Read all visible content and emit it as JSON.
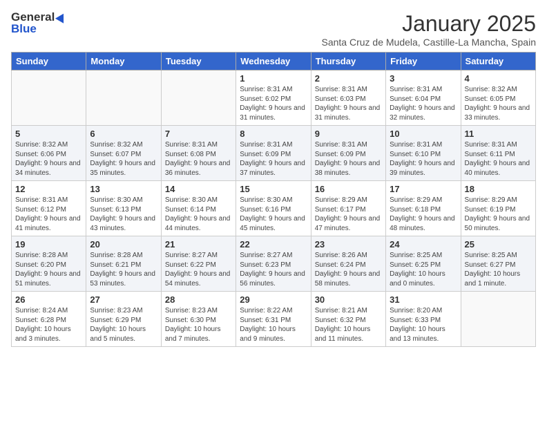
{
  "logo": {
    "line1": "General",
    "line2": "Blue"
  },
  "title": "January 2025",
  "subtitle": "Santa Cruz de Mudela, Castille-La Mancha, Spain",
  "days_of_week": [
    "Sunday",
    "Monday",
    "Tuesday",
    "Wednesday",
    "Thursday",
    "Friday",
    "Saturday"
  ],
  "weeks": [
    [
      {
        "day": "",
        "info": ""
      },
      {
        "day": "",
        "info": ""
      },
      {
        "day": "",
        "info": ""
      },
      {
        "day": "1",
        "info": "Sunrise: 8:31 AM\nSunset: 6:02 PM\nDaylight: 9 hours\nand 31 minutes."
      },
      {
        "day": "2",
        "info": "Sunrise: 8:31 AM\nSunset: 6:03 PM\nDaylight: 9 hours\nand 31 minutes."
      },
      {
        "day": "3",
        "info": "Sunrise: 8:31 AM\nSunset: 6:04 PM\nDaylight: 9 hours\nand 32 minutes."
      },
      {
        "day": "4",
        "info": "Sunrise: 8:32 AM\nSunset: 6:05 PM\nDaylight: 9 hours\nand 33 minutes."
      }
    ],
    [
      {
        "day": "5",
        "info": "Sunrise: 8:32 AM\nSunset: 6:06 PM\nDaylight: 9 hours\nand 34 minutes."
      },
      {
        "day": "6",
        "info": "Sunrise: 8:32 AM\nSunset: 6:07 PM\nDaylight: 9 hours\nand 35 minutes."
      },
      {
        "day": "7",
        "info": "Sunrise: 8:31 AM\nSunset: 6:08 PM\nDaylight: 9 hours\nand 36 minutes."
      },
      {
        "day": "8",
        "info": "Sunrise: 8:31 AM\nSunset: 6:09 PM\nDaylight: 9 hours\nand 37 minutes."
      },
      {
        "day": "9",
        "info": "Sunrise: 8:31 AM\nSunset: 6:09 PM\nDaylight: 9 hours\nand 38 minutes."
      },
      {
        "day": "10",
        "info": "Sunrise: 8:31 AM\nSunset: 6:10 PM\nDaylight: 9 hours\nand 39 minutes."
      },
      {
        "day": "11",
        "info": "Sunrise: 8:31 AM\nSunset: 6:11 PM\nDaylight: 9 hours\nand 40 minutes."
      }
    ],
    [
      {
        "day": "12",
        "info": "Sunrise: 8:31 AM\nSunset: 6:12 PM\nDaylight: 9 hours\nand 41 minutes."
      },
      {
        "day": "13",
        "info": "Sunrise: 8:30 AM\nSunset: 6:13 PM\nDaylight: 9 hours\nand 43 minutes."
      },
      {
        "day": "14",
        "info": "Sunrise: 8:30 AM\nSunset: 6:14 PM\nDaylight: 9 hours\nand 44 minutes."
      },
      {
        "day": "15",
        "info": "Sunrise: 8:30 AM\nSunset: 6:16 PM\nDaylight: 9 hours\nand 45 minutes."
      },
      {
        "day": "16",
        "info": "Sunrise: 8:29 AM\nSunset: 6:17 PM\nDaylight: 9 hours\nand 47 minutes."
      },
      {
        "day": "17",
        "info": "Sunrise: 8:29 AM\nSunset: 6:18 PM\nDaylight: 9 hours\nand 48 minutes."
      },
      {
        "day": "18",
        "info": "Sunrise: 8:29 AM\nSunset: 6:19 PM\nDaylight: 9 hours\nand 50 minutes."
      }
    ],
    [
      {
        "day": "19",
        "info": "Sunrise: 8:28 AM\nSunset: 6:20 PM\nDaylight: 9 hours\nand 51 minutes."
      },
      {
        "day": "20",
        "info": "Sunrise: 8:28 AM\nSunset: 6:21 PM\nDaylight: 9 hours\nand 53 minutes."
      },
      {
        "day": "21",
        "info": "Sunrise: 8:27 AM\nSunset: 6:22 PM\nDaylight: 9 hours\nand 54 minutes."
      },
      {
        "day": "22",
        "info": "Sunrise: 8:27 AM\nSunset: 6:23 PM\nDaylight: 9 hours\nand 56 minutes."
      },
      {
        "day": "23",
        "info": "Sunrise: 8:26 AM\nSunset: 6:24 PM\nDaylight: 9 hours\nand 58 minutes."
      },
      {
        "day": "24",
        "info": "Sunrise: 8:25 AM\nSunset: 6:25 PM\nDaylight: 10 hours\nand 0 minutes."
      },
      {
        "day": "25",
        "info": "Sunrise: 8:25 AM\nSunset: 6:27 PM\nDaylight: 10 hours\nand 1 minute."
      }
    ],
    [
      {
        "day": "26",
        "info": "Sunrise: 8:24 AM\nSunset: 6:28 PM\nDaylight: 10 hours\nand 3 minutes."
      },
      {
        "day": "27",
        "info": "Sunrise: 8:23 AM\nSunset: 6:29 PM\nDaylight: 10 hours\nand 5 minutes."
      },
      {
        "day": "28",
        "info": "Sunrise: 8:23 AM\nSunset: 6:30 PM\nDaylight: 10 hours\nand 7 minutes."
      },
      {
        "day": "29",
        "info": "Sunrise: 8:22 AM\nSunset: 6:31 PM\nDaylight: 10 hours\nand 9 minutes."
      },
      {
        "day": "30",
        "info": "Sunrise: 8:21 AM\nSunset: 6:32 PM\nDaylight: 10 hours\nand 11 minutes."
      },
      {
        "day": "31",
        "info": "Sunrise: 8:20 AM\nSunset: 6:33 PM\nDaylight: 10 hours\nand 13 minutes."
      },
      {
        "day": "",
        "info": ""
      }
    ]
  ]
}
